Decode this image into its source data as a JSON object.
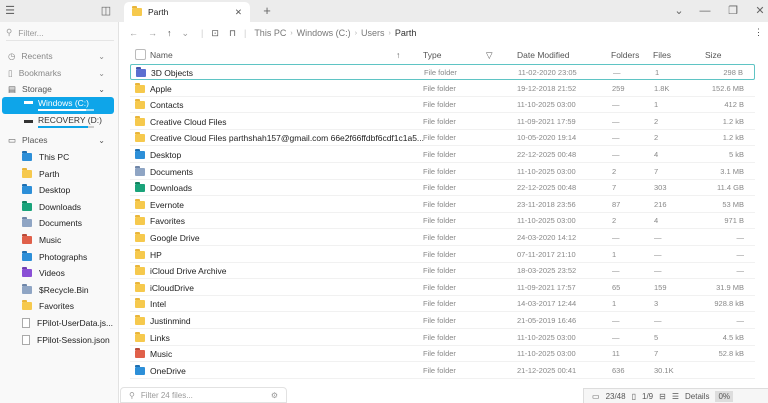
{
  "tab": {
    "title": "Parth"
  },
  "window": {
    "dropdown": "⌄",
    "minimize": "—",
    "restore": "❐",
    "close": "✕"
  },
  "sidebar": {
    "filter_placeholder": "Filter...",
    "sections": {
      "recents": "Recents",
      "bookmarks": "Bookmarks",
      "storage": "Storage",
      "places": "Places"
    },
    "drives": [
      {
        "label": "Windows (C:)",
        "usage": 0.85
      },
      {
        "label": "RECOVERY (D:)",
        "usage": 0.9
      }
    ],
    "places": [
      {
        "label": "This PC",
        "icon": "pc"
      },
      {
        "label": "Parth",
        "icon": "yellow"
      },
      {
        "label": "Desktop",
        "icon": "blue"
      },
      {
        "label": "Downloads",
        "icon": "green"
      },
      {
        "label": "Documents",
        "icon": "gray"
      },
      {
        "label": "Music",
        "icon": "red"
      },
      {
        "label": "Photographs",
        "icon": "blue"
      },
      {
        "label": "Videos",
        "icon": "purple"
      },
      {
        "label": "$Recycle.Bin",
        "icon": "recycle"
      },
      {
        "label": "Favorites",
        "icon": "yellow"
      },
      {
        "label": "FPilot-UserData.js...",
        "icon": "file"
      },
      {
        "label": "FPilot-Session.json",
        "icon": "file"
      }
    ]
  },
  "breadcrumb": [
    "This PC",
    "Windows (C:)",
    "Users",
    "Parth"
  ],
  "columns": {
    "name": "Name",
    "type": "Type",
    "date": "Date Modified",
    "folders": "Folders",
    "files": "Files",
    "size": "Size"
  },
  "rows": [
    {
      "name": "3D Objects",
      "icon": "cube",
      "type": "File folder",
      "date": "11-02-2020 23:05",
      "folders": "—",
      "files": "1",
      "size": "298 B"
    },
    {
      "name": "Apple",
      "icon": "yellow",
      "type": "File folder",
      "date": "19-12-2018 21:52",
      "folders": "259",
      "files": "1.8K",
      "size": "152.6 MB"
    },
    {
      "name": "Contacts",
      "icon": "yellow",
      "type": "File folder",
      "date": "11-10-2025 03:00",
      "folders": "—",
      "files": "1",
      "size": "412 B"
    },
    {
      "name": "Creative Cloud Files",
      "icon": "yellow",
      "type": "File folder",
      "date": "11-09-2021 17:59",
      "folders": "—",
      "files": "2",
      "size": "1.2 kB"
    },
    {
      "name": "Creative Cloud Files parthshah157@gmail.com 66e2f66ffdbf6cdf1c1a5...",
      "icon": "yellow",
      "type": "File folder",
      "date": "10-05-2020 19:14",
      "folders": "—",
      "files": "2",
      "size": "1.2 kB"
    },
    {
      "name": "Desktop",
      "icon": "blue",
      "type": "File folder",
      "date": "22-12-2025 00:48",
      "folders": "—",
      "files": "4",
      "size": "5 kB"
    },
    {
      "name": "Documents",
      "icon": "gray",
      "type": "File folder",
      "date": "11-10-2025 03:00",
      "folders": "2",
      "files": "7",
      "size": "3.1 MB"
    },
    {
      "name": "Downloads",
      "icon": "green",
      "type": "File folder",
      "date": "22-12-2025 00:48",
      "folders": "7",
      "files": "303",
      "size": "11.4 GB"
    },
    {
      "name": "Evernote",
      "icon": "yellow",
      "type": "File folder",
      "date": "23-11-2018 23:56",
      "folders": "87",
      "files": "216",
      "size": "53 MB"
    },
    {
      "name": "Favorites",
      "icon": "yellow",
      "type": "File folder",
      "date": "11-10-2025 03:00",
      "folders": "2",
      "files": "4",
      "size": "971 B"
    },
    {
      "name": "Google Drive",
      "icon": "yellow",
      "type": "File folder",
      "date": "24-03-2020 14:12",
      "folders": "—",
      "files": "—",
      "size": "—"
    },
    {
      "name": "HP",
      "icon": "yellow",
      "type": "File folder",
      "date": "07-11-2017 21:10",
      "folders": "1",
      "files": "—",
      "size": "—"
    },
    {
      "name": "iCloud Drive Archive",
      "icon": "yellow",
      "type": "File folder",
      "date": "18-03-2025 23:52",
      "folders": "—",
      "files": "—",
      "size": "—"
    },
    {
      "name": "iCloudDrive",
      "icon": "yellow",
      "type": "File folder",
      "date": "11-09-2021 17:57",
      "folders": "65",
      "files": "159",
      "size": "31.9 MB"
    },
    {
      "name": "Intel",
      "icon": "yellow",
      "type": "File folder",
      "date": "14-03-2017 12:44",
      "folders": "1",
      "files": "3",
      "size": "928.8 kB"
    },
    {
      "name": "Justinmind",
      "icon": "yellow",
      "type": "File folder",
      "date": "21-05-2019 16:46",
      "folders": "—",
      "files": "—",
      "size": "—"
    },
    {
      "name": "Links",
      "icon": "yellow",
      "type": "File folder",
      "date": "11-10-2025 03:00",
      "folders": "—",
      "files": "5",
      "size": "4.5 kB"
    },
    {
      "name": "Music",
      "icon": "red",
      "type": "File folder",
      "date": "11-10-2025 03:00",
      "folders": "11",
      "files": "7",
      "size": "52.8 kB"
    },
    {
      "name": "OneDrive",
      "icon": "blue",
      "type": "File folder",
      "date": "21-12-2025 00:41",
      "folders": "636",
      "files": "30.1K",
      "size": ""
    }
  ],
  "filter": {
    "placeholder": "Filter 24 files..."
  },
  "status": {
    "folders": "23/48",
    "files": "1/9",
    "view": "Details",
    "zoom": "0%"
  }
}
